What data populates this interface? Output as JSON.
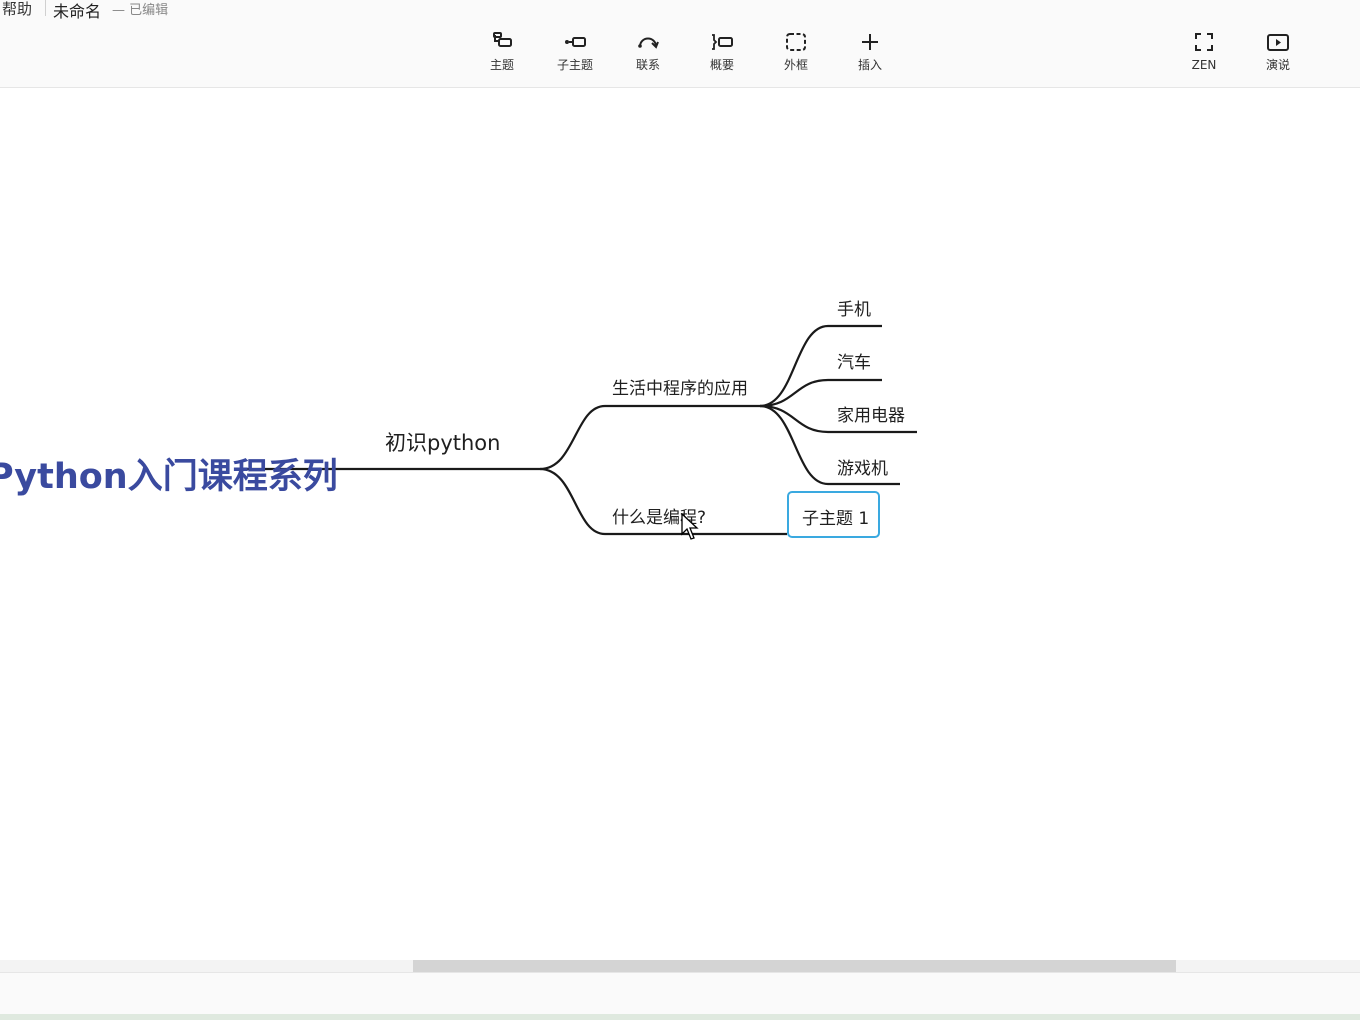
{
  "menu": {
    "help_label": "帮助"
  },
  "document": {
    "name": "未命名",
    "status": "— 已编辑"
  },
  "toolbar": {
    "topic": "主题",
    "subtopic": "子主题",
    "relationship": "联系",
    "summary": "概要",
    "boundary": "外框",
    "insert": "插入",
    "zen": "ZEN",
    "pitch": "演说"
  },
  "mindmap": {
    "central_topic": "Python入门课程系列",
    "main_topic": "初识python",
    "subtopics": [
      {
        "label": "生活中程序的应用",
        "children": [
          "手机",
          "汽车",
          "家用电器",
          "游戏机"
        ]
      },
      {
        "label": "什么是编程?",
        "children": [
          "子主题 1"
        ]
      }
    ],
    "line_color": "#1a1a1a",
    "central_color": "#3a4a9f",
    "selection_color": "#3aa9e0"
  }
}
